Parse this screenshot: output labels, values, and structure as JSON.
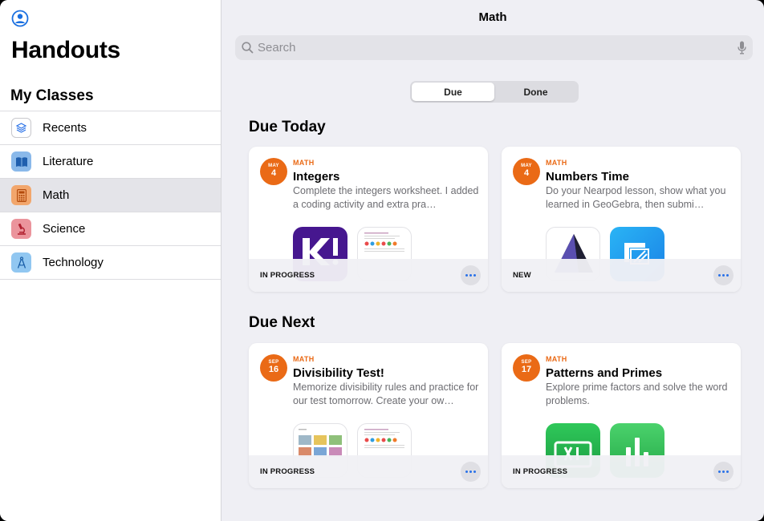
{
  "sidebar": {
    "app_title": "Handouts",
    "section_title": "My Classes",
    "items": [
      {
        "label": "Recents",
        "icon": "layers-icon",
        "color": "#ffffff",
        "selected": false
      },
      {
        "label": "Literature",
        "icon": "book-icon",
        "color": "#7fb2e8",
        "selected": false
      },
      {
        "label": "Math",
        "icon": "calculator-icon",
        "color": "#f0a066",
        "selected": true
      },
      {
        "label": "Science",
        "icon": "microscope-icon",
        "color": "#e98d96",
        "selected": false
      },
      {
        "label": "Technology",
        "icon": "compass-icon",
        "color": "#8cc4f0",
        "selected": false
      }
    ]
  },
  "main": {
    "nav_title": "Math",
    "search": {
      "placeholder": "Search"
    },
    "segments": [
      {
        "label": "Due",
        "active": true
      },
      {
        "label": "Done",
        "active": false
      }
    ],
    "groups": [
      {
        "title": "Due Today",
        "cards": [
          {
            "month": "MAY",
            "day": "4",
            "subject": "MATH",
            "title": "Integers",
            "description": "Complete the integers worksheet. I added a coding activity and extra pra…",
            "status": "IN PROGRESS",
            "attachments": [
              "kahoot-app-icon",
              "worksheet-thumbnail"
            ]
          },
          {
            "month": "MAY",
            "day": "4",
            "subject": "MATH",
            "title": "Numbers Time",
            "description": "Do your Nearpod lesson, show what you learned in GeoGebra, then submi…",
            "status": "NEW",
            "attachments": [
              "geogebra-app-icon",
              "nearpod-app-icon"
            ]
          }
        ]
      },
      {
        "title": "Due Next",
        "cards": [
          {
            "month": "SEP",
            "day": "16",
            "subject": "MATH",
            "title": "Divisibility Test!",
            "description": "Memorize divisibility rules and practice for our test tomorrow. Create your ow…",
            "status": "IN PROGRESS",
            "attachments": [
              "flashcard-thumbnail",
              "worksheet-thumbnail"
            ]
          },
          {
            "month": "SEP",
            "day": "17",
            "subject": "MATH",
            "title": "Patterns and Primes",
            "description": "Explore prime factors and solve the word problems.",
            "status": "IN PROGRESS",
            "attachments": [
              "spreadsheet-app-icon",
              "numbers-app-icon"
            ]
          }
        ]
      }
    ]
  },
  "colors": {
    "accent": "#2a72e8",
    "orange": "#ea6a16"
  }
}
